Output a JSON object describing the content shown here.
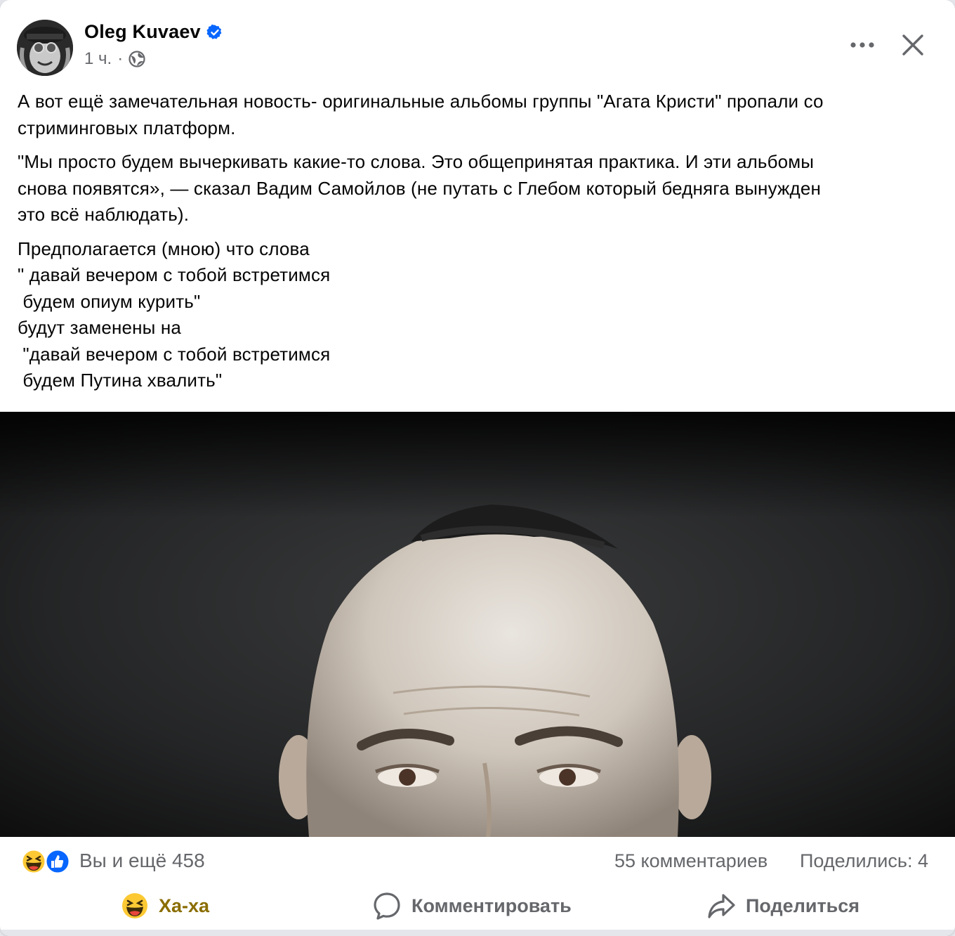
{
  "post": {
    "author": {
      "name": "Oleg Kuvaev",
      "verified": true,
      "time": "1 ч.",
      "separator": "·",
      "privacy_icon": "globe-icon"
    },
    "header_controls": {
      "more_icon": "more-horizontal-icon",
      "close_icon": "close-icon"
    },
    "paragraphs": [
      [
        "А вот ещё замечательная новость- оригинальные альбомы группы \"Агата Кристи\" пропали со",
        "стриминговых платформ."
      ],
      [
        "\"Мы просто будем вычеркивать какие-то слова. Это общепринятая практика. И эти альбомы",
        "снова появятся», — сказал Вадим Самойлов (не путать с Глебом который бедняга вынужден",
        "это всё наблюдать)."
      ],
      [
        "Предполагается (мною) что слова",
        "\" давай вечером с тобой встретимся",
        " будем опиум курить\"",
        "будут заменены на",
        " \"давай вечером с тобой встретимся",
        " будем Путина хвалить\""
      ]
    ],
    "stats": {
      "reaction_icons": [
        "haha-icon",
        "like-icon"
      ],
      "reactions": "Вы и ещё 458",
      "comments": "55 комментариев",
      "shares": "Поделились: 4"
    },
    "actions": {
      "haha": {
        "label": "Ха-ха",
        "icon": "haha-icon"
      },
      "comment": {
        "label": "Комментировать",
        "icon": "comment-icon"
      },
      "share": {
        "label": "Поделиться",
        "icon": "share-icon"
      }
    },
    "colors": {
      "accent_blue": "#0866ff",
      "secondary_text": "#65676b",
      "haha_active": "#8a6d00"
    }
  }
}
